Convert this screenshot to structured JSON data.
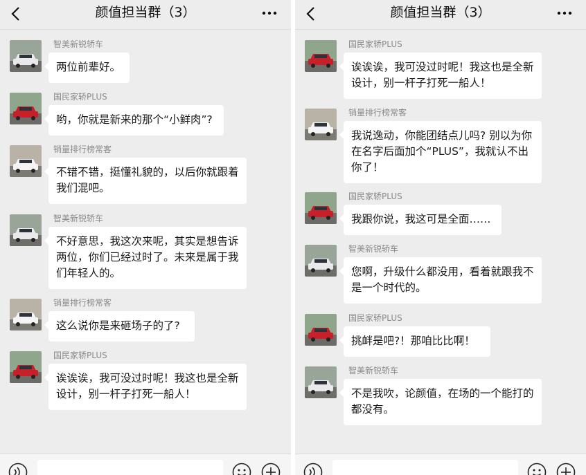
{
  "left": {
    "title": "颜值担当群（3）",
    "messages": [
      {
        "sender": "智美新锐轿车",
        "text": "两位前辈好。"
      },
      {
        "sender": "国民家轿PLUS",
        "text": "哟，你就是新来的那个“小鲜肉”?"
      },
      {
        "sender": "销量排行榜常客",
        "text": "不错不错，挺懂礼貌的，以后你就跟着我们混吧。"
      },
      {
        "sender": "智美新锐轿车",
        "text": "不好意思，我这次来呢，其实是想告诉两位，你们已经过时了。未来是属于我们年轻人的。"
      },
      {
        "sender": "销量排行榜常客",
        "text": "这么说你是来砸场子的了?"
      },
      {
        "sender": "国民家轿PLUS",
        "text": "诶诶诶，我可没过时呢！我这也是全新设计，别一杆子打死一船人！"
      }
    ]
  },
  "right": {
    "title": "颜值担当群（3）",
    "messages": [
      {
        "sender": "国民家轿PLUS",
        "text": "诶诶诶，我可没过时呢！我这也是全新设计，别一杆子打死一船人！"
      },
      {
        "sender": "销量排行榜常客",
        "text": "我说逸动，你能团结点儿吗? 别以为你在名字后面加个“PLUS”，我就认不出你了！"
      },
      {
        "sender": "国民家轿PLUS",
        "text": "我跟你说，我这可是全面……"
      },
      {
        "sender": "智美新锐轿车",
        "text": "您啊，升级什么都没用，看着就跟我不是一个时代的。"
      },
      {
        "sender": "国民家轿PLUS",
        "text": "挑衅是吧?！那咱比比啊！"
      },
      {
        "sender": "智美新锐轿车",
        "text": "不是我吹，论颜值，在场的一个能打的都没有。"
      }
    ]
  },
  "avatar_colors": {
    "智美新锐轿车": "#e9e9ec",
    "国民家轿PLUS": "#c8202a",
    "销量排行榜常客": "#f4f4f4"
  },
  "icons": {
    "back": "chevron-left-icon",
    "more": "more-dots-icon",
    "voice": "voice-icon",
    "emoji": "emoji-icon",
    "plus": "plus-icon"
  }
}
